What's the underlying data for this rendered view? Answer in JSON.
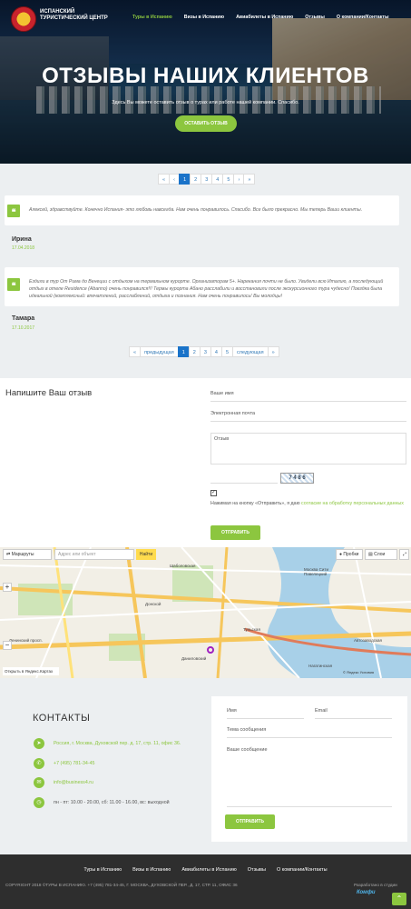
{
  "header": {
    "logo_text": "ИСПАНСКИЙ ТУРИСТИЧЕСКИЙ ЦЕНТР",
    "nav": [
      "Туры в Испанию",
      "Визы в Испанию",
      "Авиабилеты в Испанию",
      "Отзывы",
      "О компании/Контакты"
    ]
  },
  "hero": {
    "title": "ОТЗЫВЫ НАШИХ КЛИЕНТОВ",
    "subtitle": "Здесь Вы можете оставить отзыв о турах или работе нашей компании. Спасибо.",
    "cta": "ОСТАВИТЬ ОТЗЫВ"
  },
  "pager_top": [
    "«",
    "‹",
    "1",
    "2",
    "3",
    "4",
    "5",
    "›",
    "»"
  ],
  "reviews": [
    {
      "text": "Алексей, здравствуйте. Конечно Испания- это любовь навсегда. Нам очень понравилось. Спасибо. Все было прекрасно. Мы теперь Ваши клиенты.",
      "name": "Ирина",
      "date": "17.04.2018"
    },
    {
      "text": "Ездили в тур От Рима до Венеции с отдыхом на термальном курорте. Организаторам 5+. Нарекания почти не было. Увидели всю Италию, а последующий отдых в отеле Residence (Abanno) очень понравился!!! Термы курорта Абано расслабили и восстановили после экскурсионного тура чудесно! Поездка была идеальной (комплексный: впечатлений, расслаблений, отдыха и познания. Нам очень понравилось! Вы молодцы!",
      "name": "Тамара",
      "date": "17.10.2017"
    }
  ],
  "pager_bottom": [
    "«",
    "предыдущая",
    "1",
    "2",
    "3",
    "4",
    "5",
    "следующая",
    "»"
  ],
  "review_form": {
    "title": "Напишите Ваш отзыв",
    "name_placeholder": "Ваше имя",
    "email_placeholder": "Электронная почта",
    "review_placeholder": "Отзыв",
    "captcha": "7 4 8 6",
    "consent_prefix": "Нажимая на кнопку «Отправить», я даю ",
    "consent_link": "согласие на обработку персональных данных",
    "submit": "ОТПРАВИТЬ"
  },
  "map": {
    "routes_label": "Маршруты",
    "search_placeholder": "Адрес или объект",
    "find_label": "Найти",
    "traffic_label": "Пробки",
    "layers_label": "Слои",
    "open_label": "Открыть в Яндекс.Картах",
    "footer_text": "© Яндекс  Условия",
    "labels": [
      "Шаболовская",
      "Донской",
      "Даниловский",
      "Москва Сити Павелецкий",
      "Тульская",
      "Автозаводская",
      "Нагатинская",
      "Ленинский просп."
    ]
  },
  "contacts": {
    "title": "КОНТАКТЫ",
    "address": "Россия, г. Москва, Духовской пер. д. 17, стр. 11, офис 36.",
    "phone": "+7 (495) 781-34-45",
    "email": "info@business4.ru",
    "hours": "пн - пт: 10.00 - 20.00, сб: 11.00 - 16.00, вс: выходной"
  },
  "contact_form": {
    "name_placeholder": "Имя",
    "email_placeholder": "Email",
    "subject_placeholder": "Тема сообщения",
    "message_placeholder": "Ваше сообщение",
    "submit": "ОТПРАВИТЬ"
  },
  "footer": {
    "nav": [
      "Туры в Испанию",
      "Визы в Испанию",
      "Авиабилеты в Испанию",
      "Отзывы",
      "О компании/Контакты"
    ],
    "copyright": "COPYRIGHT 2018 ©ТУРЫ В ИСПАНИЮ. +7 (495) 781-34-45, Г. МОСКВА, ДУХОВСКОЙ ПЕР., Д. 17, СТР. 11, ОФИС 36",
    "studio_label": "Разработано в студии",
    "studio_name": "Комфи"
  },
  "colors": {
    "accent": "#8cc63f",
    "pager_active": "#1a73c9",
    "footer_bg": "#2e2e2e",
    "section_bg": "#eceff1"
  }
}
